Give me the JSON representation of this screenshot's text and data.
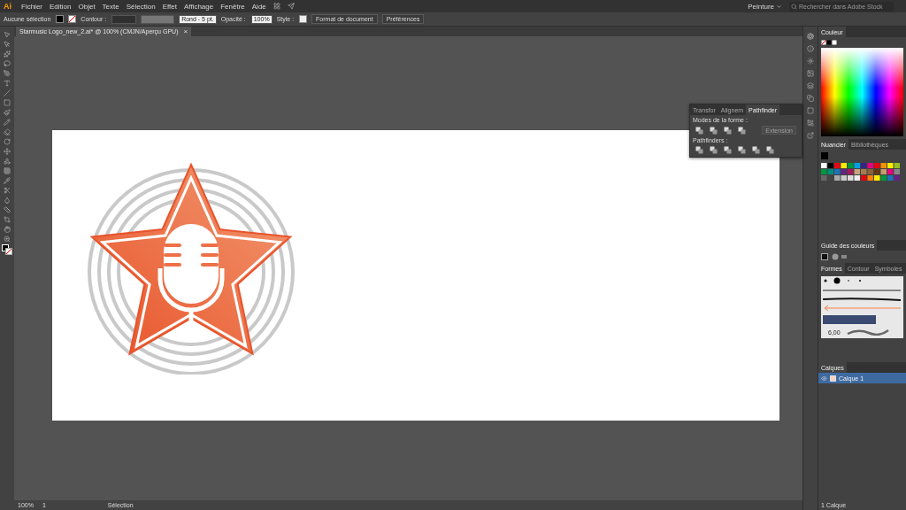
{
  "app": {
    "logo": "Ai"
  },
  "menu": [
    "Fichier",
    "Edition",
    "Objet",
    "Texte",
    "Sélection",
    "Effet",
    "Affichage",
    "Fenêtre",
    "Aide"
  ],
  "workspace": "Peinture",
  "search": {
    "placeholder": "Rechercher dans Adobe Stock"
  },
  "control_bar": {
    "selection": "Aucune sélection",
    "stroke_label": "Contour :",
    "brush": "Rond - 5 pt.",
    "opacity_label": "Opacité :",
    "opacity": "100%",
    "style_label": "Style :",
    "buttons": [
      "Format de document",
      "Préférences"
    ]
  },
  "document_tab": {
    "title": "Starmusic Logo_new_2.ai* @ 100% (CMJN/Aperçu GPU)",
    "close": "×"
  },
  "pathfinder": {
    "tabs": [
      {
        "label": "Transfor",
        "selected": false
      },
      {
        "label": "Alignem",
        "selected": false
      },
      {
        "label": "Pathfinder",
        "selected": true
      }
    ],
    "shape_modes_label": "Modes de la forme :",
    "expand": "Extension",
    "pathfinders_label": "Pathfinders :"
  },
  "color_panel": {
    "title": "Couleur"
  },
  "swatches_panel": {
    "tabs": [
      {
        "label": "Nuancier",
        "selected": true
      },
      {
        "label": "Bibliothèques",
        "selected": false
      }
    ]
  },
  "color_guide": {
    "title": "Guide des couleurs"
  },
  "brushes_panel": {
    "tabs": [
      {
        "label": "Formes",
        "selected": true
      },
      {
        "label": "Contour",
        "selected": false
      },
      {
        "label": "Symboles",
        "selected": false
      }
    ],
    "size": "6,00"
  },
  "layers_panel": {
    "title": "Calques",
    "layers": [
      {
        "name": "Calque 1",
        "visible": true,
        "selected": true
      }
    ],
    "count": "1 Calque"
  },
  "status_bar": {
    "zoom": "100%",
    "artboard": "1",
    "tool": "Sélection"
  }
}
